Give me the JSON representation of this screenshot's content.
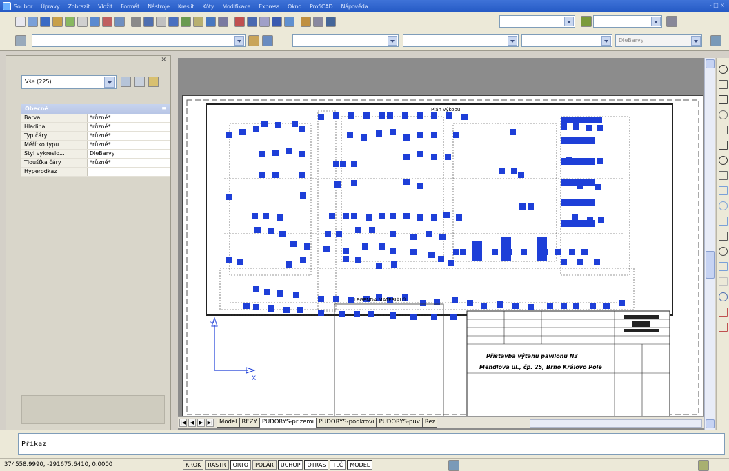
{
  "menu": [
    "Soubor",
    "Úpravy",
    "Zobrazit",
    "Vložit",
    "Formát",
    "Nástroje",
    "Kreslit",
    "Kóty",
    "Modifikace",
    "Express",
    "Okno",
    "ProfiCAD",
    "Nápověda"
  ],
  "window_controls": "- □ ×",
  "properties": {
    "selection": "Vše (225)",
    "section_title": "Obecné",
    "rows": [
      {
        "key": "Barva",
        "value": "*různé*"
      },
      {
        "key": "Hladina",
        "value": "*různé*"
      },
      {
        "key": "Typ čáry",
        "value": "*různé*"
      },
      {
        "key": "Měřítko typu...",
        "value": "*různé*"
      },
      {
        "key": "Styl vykreslo...",
        "value": "DleBarvy"
      },
      {
        "key": "Tloušťka čáry",
        "value": "*různé*"
      },
      {
        "key": "Hyperodkaz",
        "value": ""
      }
    ]
  },
  "toolbar2": {
    "plot_style": "DleBarvy"
  },
  "drawing": {
    "legend_title": "LEGENDA MATERIÁLŮ",
    "ucs_x": "X",
    "ucs_y": "Y",
    "label_top": "Plán výkopu",
    "title_line1": "Přístavba výtahu pavilonu N3",
    "title_line2": "Mendlova ul., čp. 25, Brno Královo Pole"
  },
  "tabs": [
    "Model",
    "REZY",
    "PUDORYS-prizemi",
    "PUDORYS-podkrovi",
    "PUDORYS-puv",
    "Rez"
  ],
  "active_tab": "PUDORYS-prizemi",
  "command": {
    "prompt": "Příkaz"
  },
  "status": {
    "coords": "374558.9990, -291675.6410, 0.0000",
    "buttons": [
      {
        "label": "KROK",
        "on": false
      },
      {
        "label": "RASTR",
        "on": false
      },
      {
        "label": "ORTO",
        "on": true
      },
      {
        "label": "POLÁR",
        "on": false
      },
      {
        "label": "UCHOP",
        "on": true
      },
      {
        "label": "OTRAS",
        "on": true
      },
      {
        "label": "TLČ",
        "on": true
      },
      {
        "label": "MODEL",
        "on": true
      }
    ]
  },
  "colors": {
    "grip": "#1e3fd8",
    "title_bar": "#2a5fc8",
    "canvas_bg": "#8c8c8c"
  }
}
